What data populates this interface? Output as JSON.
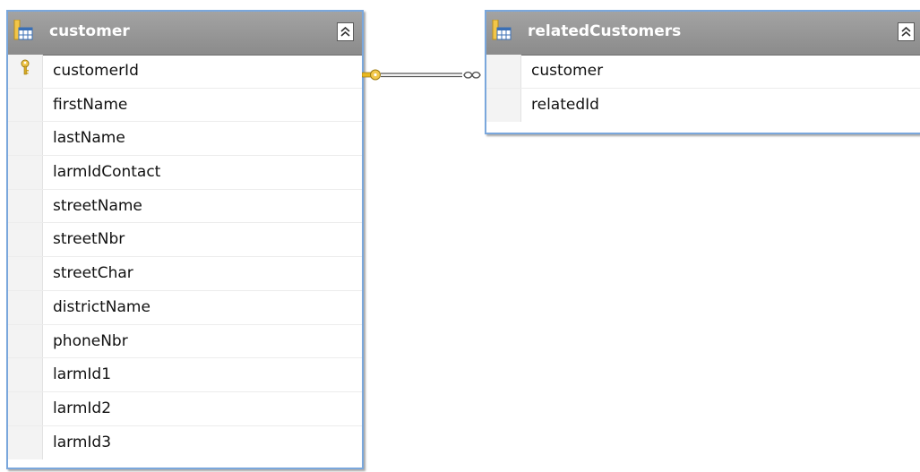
{
  "diagram": {
    "tables": [
      {
        "name": "customer",
        "icon": "table-icon",
        "collapse_icon": "collapse-up-icon",
        "columns": [
          {
            "name": "customerId",
            "primary_key": true
          },
          {
            "name": "firstName"
          },
          {
            "name": "lastName"
          },
          {
            "name": "larmIdContact"
          },
          {
            "name": "streetName"
          },
          {
            "name": "streetNbr"
          },
          {
            "name": "streetChar"
          },
          {
            "name": "districtName"
          },
          {
            "name": "phoneNbr"
          },
          {
            "name": "larmId1"
          },
          {
            "name": "larmId2"
          },
          {
            "name": "larmId3"
          }
        ]
      },
      {
        "name": "relatedCustomers",
        "icon": "table-icon",
        "collapse_icon": "collapse-up-icon",
        "columns": [
          {
            "name": "customer"
          },
          {
            "name": "relatedId"
          }
        ]
      }
    ],
    "relationship": {
      "from_end": "key-icon",
      "to_end": "infinity-icon",
      "from_table": "customer",
      "to_table": "relatedCustomers"
    },
    "colors": {
      "header_bg": "#999999",
      "border_accent": "#7aa7dc",
      "key": "#e0b020"
    }
  }
}
